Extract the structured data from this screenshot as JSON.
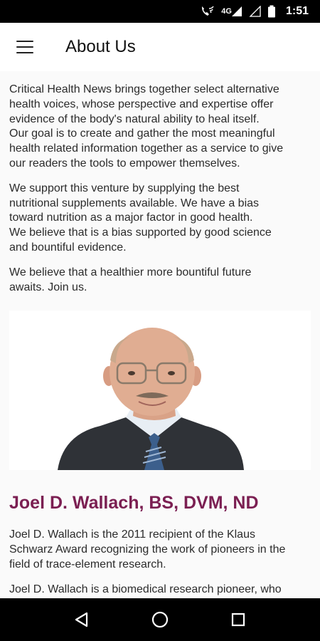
{
  "status_bar": {
    "network": "4G",
    "time": "1:51"
  },
  "app_bar": {
    "title": "About Us"
  },
  "content": {
    "intro_lines": [
      "Critical Health News brings together select alternative",
      "health voices, whose perspective and expertise offer",
      "evidence of the body's natural ability to heal itself.",
      "Our goal is to create and gather the most meaningful",
      "health related information together as a service to give",
      "our readers the tools to empower themselves."
    ],
    "support_lines": [
      "We support this venture by supplying the best",
      "nutritional supplements available.  We have a bias",
      "toward nutrition as a major factor in good health.",
      "We believe that is a bias supported by good science",
      "and bountiful evidence."
    ],
    "future_lines": [
      "We believe that a healthier more bountiful future",
      "awaits. Join us."
    ],
    "person_name": "Joel D. Wallach, BS, DVM, ND",
    "bio1_lines": [
      "Joel D. Wallach is the 2011 recipient of the Klaus",
      "Schwarz Award recognizing the work of pioneers in the",
      "field of trace-element research."
    ],
    "bio2_lines": [
      "Joel D. Wallach is a biomedical research pioneer, who"
    ]
  },
  "colors": {
    "accent_name": "#7b1f52",
    "status_bar_bg": "#000000",
    "nav_bar_bg": "#000000"
  },
  "icons": {
    "menu": "hamburger-menu-icon",
    "wifi_call": "wifi-calling-icon",
    "signal": "cell-signal-icon",
    "battery": "battery-icon",
    "back": "nav-back-icon",
    "home": "nav-home-icon",
    "recents": "nav-recents-icon"
  }
}
